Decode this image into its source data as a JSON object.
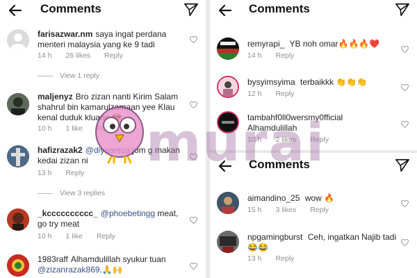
{
  "screens": [
    {
      "header": {
        "title": "Comments"
      }
    },
    {
      "header": {
        "title": "Comments"
      }
    },
    {
      "header": {
        "title": "Comments"
      }
    }
  ],
  "left": {
    "comments": [
      {
        "user": "farisazwar.nm",
        "text": "saya ingat perdana menteri malaysia yang ke 9 tadi",
        "time": "14 h",
        "likes": "26 likes",
        "reply": "Reply"
      },
      {
        "user": "maljenyz",
        "text": "Bro zizan nanti Kirim Salam shahrul bin kamarulzamaan yee Klau kenal duduk kluang 😎",
        "time": "10 h",
        "likes": "1 like",
        "reply": "Reply"
      },
      {
        "user": "hafizrazak2",
        "mention": "@diyaareza",
        "text": "jom g makan kedai zizan ni",
        "time": "13 h",
        "reply": "Reply"
      },
      {
        "user": "_kcccccccccc_",
        "mention": "@phoebetingg",
        "text": "meat, go try meat",
        "time": "10 h",
        "likes": "1 like",
        "reply": "Reply"
      },
      {
        "user": "1983raff",
        "text": "Alhamdulillah syukur tuan",
        "mention": "@zizanrazak869",
        "emoji": ".🙏🙌"
      }
    ],
    "view_replies": [
      "View 1 reply",
      "View 3 replies"
    ]
  },
  "right_top": {
    "comments": [
      {
        "user": "remyrapi_",
        "text": "YB noh omar🔥🔥🔥❤️",
        "time": "14 h",
        "reply": "Reply"
      },
      {
        "user": "bysyimsyima",
        "text": "terbaikkk 👏👏👏",
        "time": "12 h",
        "reply": "Reply"
      },
      {
        "user": "tambahf0ll0wersmy0fficial",
        "text": "Alhamdulillah",
        "time": "10 h",
        "likes": "2 likes",
        "reply": "Reply"
      }
    ]
  },
  "right_bottom": {
    "comments": [
      {
        "user": "aimandino_25",
        "text": "wow 🔥",
        "time": "15 h",
        "likes": "3 likes",
        "reply": "Reply"
      },
      {
        "user": "npgamingburst",
        "text": "Ceh, ingatkan Najib tadi 😂😂",
        "time": "13 h",
        "reply": "Reply"
      }
    ]
  },
  "watermark": {
    "text": "murai"
  }
}
